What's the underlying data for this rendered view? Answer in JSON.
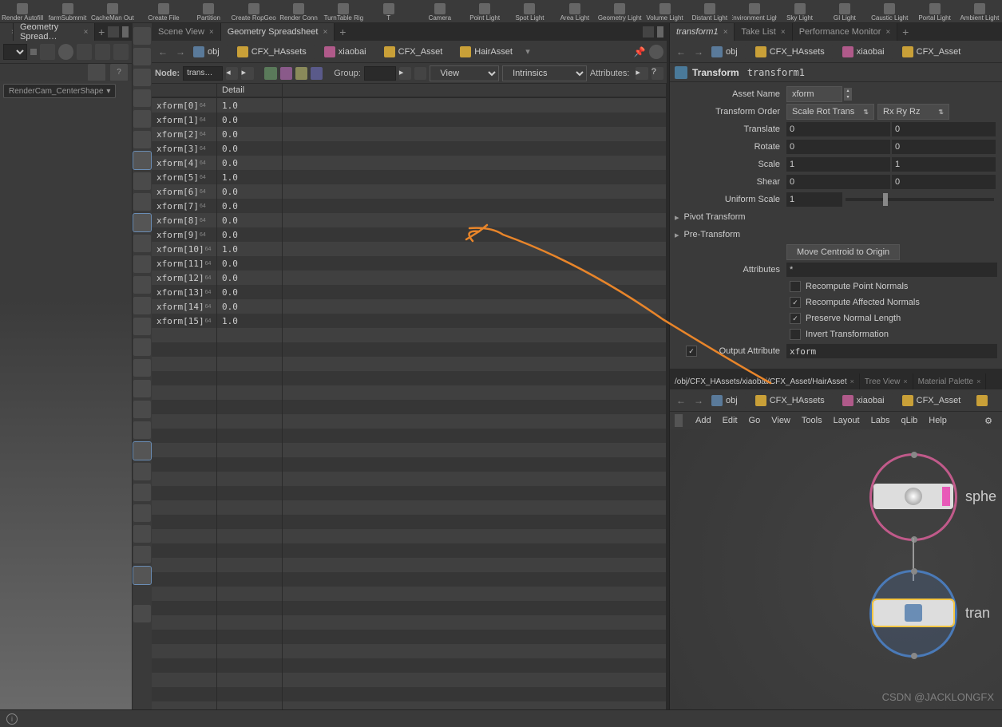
{
  "shelf": [
    "Render Autofill",
    "farmSubmmit",
    "CacheMan Out",
    "Create File",
    "Partition",
    "Create RopGeo",
    "Render Conn",
    "TurnTable Rig",
    "T",
    "Camera",
    "Point Light",
    "Spot Light",
    "Area Light",
    "Geometry Light",
    "Volume Light",
    "Distant Light",
    "Environment Light",
    "Sky Light",
    "GI Light",
    "Caustic Light",
    "Portal Light",
    "Ambient Light"
  ],
  "left_tab": "Geometry Spread…",
  "camera": "RenderCam_CenterShape",
  "center_tabs": [
    "Scene View",
    "Geometry Spreadsheet"
  ],
  "path": {
    "obj": "obj",
    "items": [
      "CFX_HAssets",
      "xiaobai",
      "CFX_Asset",
      "HairAsset"
    ]
  },
  "spreadsheet": {
    "node_label": "Node:",
    "node_value": "trans…",
    "group_label": "Group:",
    "view_label": "View",
    "intrinsics_label": "Intrinsics",
    "attributes_label": "Attributes:",
    "header": [
      "",
      "Detail"
    ],
    "rows": [
      {
        "k": "xform[0]",
        "v": "1.0"
      },
      {
        "k": "xform[1]",
        "v": "0.0"
      },
      {
        "k": "xform[2]",
        "v": "0.0"
      },
      {
        "k": "xform[3]",
        "v": "0.0"
      },
      {
        "k": "xform[4]",
        "v": "0.0"
      },
      {
        "k": "xform[5]",
        "v": "1.0"
      },
      {
        "k": "xform[6]",
        "v": "0.0"
      },
      {
        "k": "xform[7]",
        "v": "0.0"
      },
      {
        "k": "xform[8]",
        "v": "0.0"
      },
      {
        "k": "xform[9]",
        "v": "0.0"
      },
      {
        "k": "xform[10]",
        "v": "1.0"
      },
      {
        "k": "xform[11]",
        "v": "0.0"
      },
      {
        "k": "xform[12]",
        "v": "0.0"
      },
      {
        "k": "xform[13]",
        "v": "0.0"
      },
      {
        "k": "xform[14]",
        "v": "0.0"
      },
      {
        "k": "xform[15]",
        "v": "1.0"
      }
    ],
    "sub": "64"
  },
  "right_tabs": [
    "transform1",
    "Take List",
    "Performance Monitor"
  ],
  "parm": {
    "header_label": "Transform",
    "header_value": "transform1",
    "asset_name_label": "Asset Name",
    "asset_name": "xform",
    "xform_order_label": "Transform Order",
    "xform_order": "Scale Rot Trans",
    "rot_order": "Rx Ry Rz",
    "translate_label": "Translate",
    "translate": [
      "0",
      "0"
    ],
    "rotate_label": "Rotate",
    "rotate": [
      "0",
      "0"
    ],
    "scale_label": "Scale",
    "scale": [
      "1",
      "1"
    ],
    "shear_label": "Shear",
    "shear": [
      "0",
      "0"
    ],
    "uniform_scale_label": "Uniform Scale",
    "uniform_scale": "1",
    "pivot": "Pivot Transform",
    "pretransform": "Pre-Transform",
    "move_centroid": "Move Centroid to Origin",
    "attributes_label": "Attributes",
    "attributes": "*",
    "chk_point_normals": "Recompute Point Normals",
    "chk_affected": "Recompute Affected Normals",
    "chk_preserve": "Preserve Normal Length",
    "chk_invert": "Invert Transformation",
    "output_attr_label": "Output Attribute",
    "output_attr": "xform"
  },
  "lower": {
    "path": "/obj/CFX_HAssets/xiaobai/CFX_Asset/HairAsset",
    "tabs": [
      "Tree View",
      "Material Palette"
    ],
    "menu": [
      "Add",
      "Edit",
      "Go",
      "View",
      "Tools",
      "Layout",
      "Labs",
      "qLib",
      "Help"
    ],
    "node1": "sphe",
    "node2": "tran",
    "watermark": "CSDN @JACKLONGFX"
  }
}
